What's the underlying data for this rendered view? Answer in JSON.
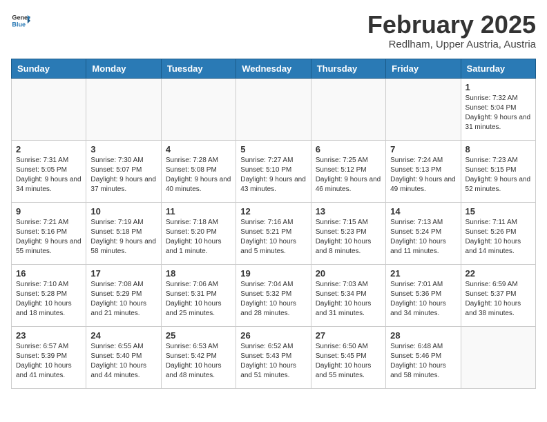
{
  "header": {
    "logo_general": "General",
    "logo_blue": "Blue",
    "month_title": "February 2025",
    "location": "Redlham, Upper Austria, Austria"
  },
  "weekdays": [
    "Sunday",
    "Monday",
    "Tuesday",
    "Wednesday",
    "Thursday",
    "Friday",
    "Saturday"
  ],
  "weeks": [
    [
      {
        "day": "",
        "info": ""
      },
      {
        "day": "",
        "info": ""
      },
      {
        "day": "",
        "info": ""
      },
      {
        "day": "",
        "info": ""
      },
      {
        "day": "",
        "info": ""
      },
      {
        "day": "",
        "info": ""
      },
      {
        "day": "1",
        "info": "Sunrise: 7:32 AM\nSunset: 5:04 PM\nDaylight: 9 hours and 31 minutes."
      }
    ],
    [
      {
        "day": "2",
        "info": "Sunrise: 7:31 AM\nSunset: 5:05 PM\nDaylight: 9 hours and 34 minutes."
      },
      {
        "day": "3",
        "info": "Sunrise: 7:30 AM\nSunset: 5:07 PM\nDaylight: 9 hours and 37 minutes."
      },
      {
        "day": "4",
        "info": "Sunrise: 7:28 AM\nSunset: 5:08 PM\nDaylight: 9 hours and 40 minutes."
      },
      {
        "day": "5",
        "info": "Sunrise: 7:27 AM\nSunset: 5:10 PM\nDaylight: 9 hours and 43 minutes."
      },
      {
        "day": "6",
        "info": "Sunrise: 7:25 AM\nSunset: 5:12 PM\nDaylight: 9 hours and 46 minutes."
      },
      {
        "day": "7",
        "info": "Sunrise: 7:24 AM\nSunset: 5:13 PM\nDaylight: 9 hours and 49 minutes."
      },
      {
        "day": "8",
        "info": "Sunrise: 7:23 AM\nSunset: 5:15 PM\nDaylight: 9 hours and 52 minutes."
      }
    ],
    [
      {
        "day": "9",
        "info": "Sunrise: 7:21 AM\nSunset: 5:16 PM\nDaylight: 9 hours and 55 minutes."
      },
      {
        "day": "10",
        "info": "Sunrise: 7:19 AM\nSunset: 5:18 PM\nDaylight: 9 hours and 58 minutes."
      },
      {
        "day": "11",
        "info": "Sunrise: 7:18 AM\nSunset: 5:20 PM\nDaylight: 10 hours and 1 minute."
      },
      {
        "day": "12",
        "info": "Sunrise: 7:16 AM\nSunset: 5:21 PM\nDaylight: 10 hours and 5 minutes."
      },
      {
        "day": "13",
        "info": "Sunrise: 7:15 AM\nSunset: 5:23 PM\nDaylight: 10 hours and 8 minutes."
      },
      {
        "day": "14",
        "info": "Sunrise: 7:13 AM\nSunset: 5:24 PM\nDaylight: 10 hours and 11 minutes."
      },
      {
        "day": "15",
        "info": "Sunrise: 7:11 AM\nSunset: 5:26 PM\nDaylight: 10 hours and 14 minutes."
      }
    ],
    [
      {
        "day": "16",
        "info": "Sunrise: 7:10 AM\nSunset: 5:28 PM\nDaylight: 10 hours and 18 minutes."
      },
      {
        "day": "17",
        "info": "Sunrise: 7:08 AM\nSunset: 5:29 PM\nDaylight: 10 hours and 21 minutes."
      },
      {
        "day": "18",
        "info": "Sunrise: 7:06 AM\nSunset: 5:31 PM\nDaylight: 10 hours and 25 minutes."
      },
      {
        "day": "19",
        "info": "Sunrise: 7:04 AM\nSunset: 5:32 PM\nDaylight: 10 hours and 28 minutes."
      },
      {
        "day": "20",
        "info": "Sunrise: 7:03 AM\nSunset: 5:34 PM\nDaylight: 10 hours and 31 minutes."
      },
      {
        "day": "21",
        "info": "Sunrise: 7:01 AM\nSunset: 5:36 PM\nDaylight: 10 hours and 34 minutes."
      },
      {
        "day": "22",
        "info": "Sunrise: 6:59 AM\nSunset: 5:37 PM\nDaylight: 10 hours and 38 minutes."
      }
    ],
    [
      {
        "day": "23",
        "info": "Sunrise: 6:57 AM\nSunset: 5:39 PM\nDaylight: 10 hours and 41 minutes."
      },
      {
        "day": "24",
        "info": "Sunrise: 6:55 AM\nSunset: 5:40 PM\nDaylight: 10 hours and 44 minutes."
      },
      {
        "day": "25",
        "info": "Sunrise: 6:53 AM\nSunset: 5:42 PM\nDaylight: 10 hours and 48 minutes."
      },
      {
        "day": "26",
        "info": "Sunrise: 6:52 AM\nSunset: 5:43 PM\nDaylight: 10 hours and 51 minutes."
      },
      {
        "day": "27",
        "info": "Sunrise: 6:50 AM\nSunset: 5:45 PM\nDaylight: 10 hours and 55 minutes."
      },
      {
        "day": "28",
        "info": "Sunrise: 6:48 AM\nSunset: 5:46 PM\nDaylight: 10 hours and 58 minutes."
      },
      {
        "day": "",
        "info": ""
      }
    ]
  ]
}
